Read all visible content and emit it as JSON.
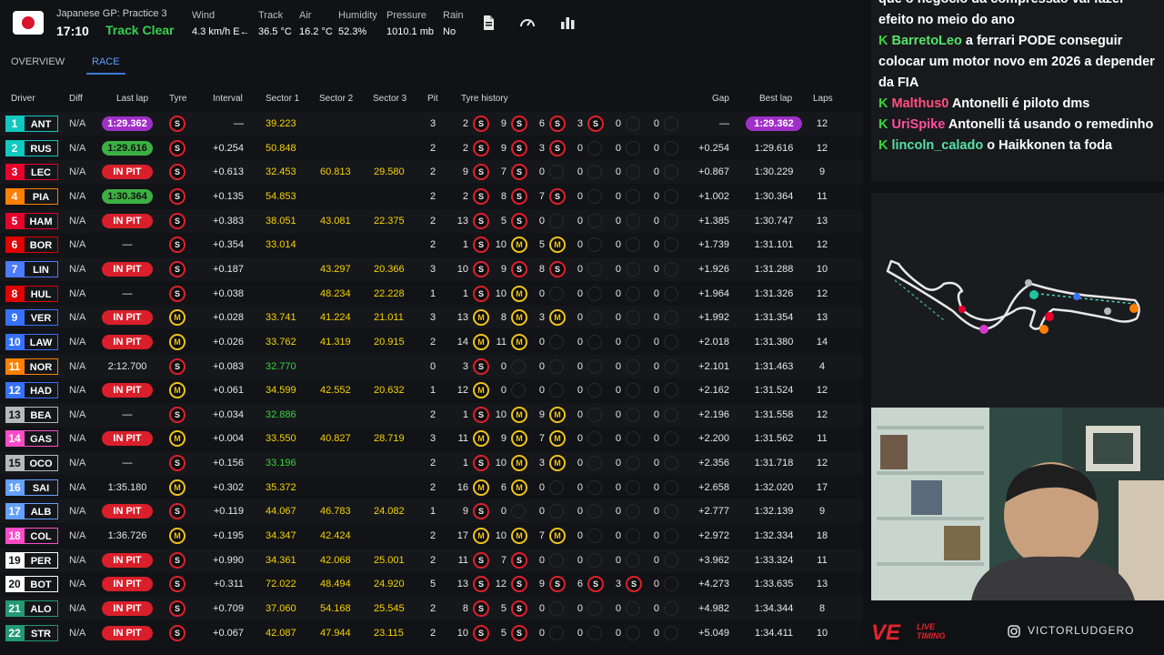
{
  "header": {
    "session": "Japanese GP: Practice 3",
    "clock": "17:10",
    "track_status": "Track Clear",
    "weather": [
      {
        "label": "Wind",
        "value": "4.3 km/h E←"
      },
      {
        "label": "Track",
        "value": "36.5 °C"
      },
      {
        "label": "Air",
        "value": "16.2 °C"
      },
      {
        "label": "Humidity",
        "value": "52.3%"
      },
      {
        "label": "Pressure",
        "value": "1010.1 mb"
      },
      {
        "label": "Rain",
        "value": "No"
      }
    ]
  },
  "tabs": [
    "OVERVIEW",
    "RACE"
  ],
  "columns": [
    "Driver",
    "Diff",
    "Last lap",
    "Tyre",
    "Interval",
    "Sector 1",
    "Sector 2",
    "Sector 3",
    "Pit",
    "Tyre history",
    "Gap",
    "Best lap",
    "Laps"
  ],
  "drivers": [
    {
      "pos": "1",
      "code": "ANT",
      "color": "#11c9c0",
      "diff": "N/A",
      "last": "1:29.362",
      "last_style": "purple",
      "tyre": "S",
      "interval": "—",
      "s1": "39.223",
      "s1c": "yellow",
      "s2": "",
      "s2c": "white",
      "s3": "",
      "s3c": "white",
      "pit": "3",
      "hist": [
        [
          "2",
          "S"
        ],
        [
          "9",
          "S"
        ],
        [
          "6",
          "S"
        ],
        [
          "3",
          "S"
        ],
        [
          "0",
          ""
        ],
        [
          "0",
          ""
        ]
      ],
      "gap": "—",
      "best": "1:29.362",
      "best_purple": true,
      "laps": "12"
    },
    {
      "pos": "2",
      "code": "RUS",
      "color": "#11c9c0",
      "diff": "N/A",
      "last": "1:29.616",
      "last_style": "green",
      "tyre": "S",
      "interval": "+0.254",
      "s1": "50.848",
      "s1c": "yellow",
      "s2": "",
      "s2c": "white",
      "s3": "",
      "s3c": "white",
      "pit": "2",
      "hist": [
        [
          "2",
          "S"
        ],
        [
          "9",
          "S"
        ],
        [
          "3",
          "S"
        ],
        [
          "0",
          ""
        ],
        [
          "0",
          ""
        ],
        [
          "0",
          ""
        ]
      ],
      "gap": "+0.254",
      "best": "1:29.616",
      "best_purple": false,
      "laps": "12"
    },
    {
      "pos": "3",
      "code": "LEC",
      "color": "#e8002d",
      "diff": "N/A",
      "last": "IN PIT",
      "last_style": "pit",
      "tyre": "S",
      "interval": "+0.613",
      "s1": "32.453",
      "s1c": "yellow",
      "s2": "60.813",
      "s2c": "yellow",
      "s3": "29.580",
      "s3c": "yellow",
      "pit": "2",
      "hist": [
        [
          "9",
          "S"
        ],
        [
          "7",
          "S"
        ],
        [
          "0",
          ""
        ],
        [
          "0",
          ""
        ],
        [
          "0",
          ""
        ],
        [
          "0",
          ""
        ]
      ],
      "gap": "+0.867",
      "best": "1:30.229",
      "best_purple": false,
      "laps": "9"
    },
    {
      "pos": "4",
      "code": "PIA",
      "color": "#ff8000",
      "diff": "N/A",
      "last": "1:30.364",
      "last_style": "green",
      "tyre": "S",
      "interval": "+0.135",
      "s1": "54.853",
      "s1c": "yellow",
      "s2": "",
      "s2c": "white",
      "s3": "",
      "s3c": "white",
      "pit": "2",
      "hist": [
        [
          "2",
          "S"
        ],
        [
          "8",
          "S"
        ],
        [
          "7",
          "S"
        ],
        [
          "0",
          ""
        ],
        [
          "0",
          ""
        ],
        [
          "0",
          ""
        ]
      ],
      "gap": "+1.002",
      "best": "1:30.364",
      "best_purple": false,
      "laps": "11"
    },
    {
      "pos": "5",
      "code": "HAM",
      "color": "#e8002d",
      "diff": "N/A",
      "last": "IN PIT",
      "last_style": "pit",
      "tyre": "S",
      "interval": "+0.383",
      "s1": "38.051",
      "s1c": "yellow",
      "s2": "43.081",
      "s2c": "yellow",
      "s3": "22.375",
      "s3c": "yellow",
      "pit": "2",
      "hist": [
        [
          "13",
          "S"
        ],
        [
          "5",
          "S"
        ],
        [
          "0",
          ""
        ],
        [
          "0",
          ""
        ],
        [
          "0",
          ""
        ],
        [
          "0",
          ""
        ]
      ],
      "gap": "+1.385",
      "best": "1:30.747",
      "best_purple": false,
      "laps": "13"
    },
    {
      "pos": "6",
      "code": "BOR",
      "color": "#e00000",
      "diff": "N/A",
      "last": "—",
      "last_style": "plain",
      "tyre": "S",
      "interval": "+0.354",
      "s1": "33.014",
      "s1c": "yellow",
      "s2": "",
      "s2c": "white",
      "s3": "",
      "s3c": "white",
      "pit": "2",
      "hist": [
        [
          "1",
          "S"
        ],
        [
          "10",
          "M"
        ],
        [
          "5",
          "M"
        ],
        [
          "0",
          ""
        ],
        [
          "0",
          ""
        ],
        [
          "0",
          ""
        ]
      ],
      "gap": "+1.739",
      "best": "1:31.101",
      "best_purple": false,
      "laps": "12"
    },
    {
      "pos": "7",
      "code": "LIN",
      "color": "#4b7bff",
      "diff": "N/A",
      "last": "IN PIT",
      "last_style": "pit",
      "tyre": "S",
      "interval": "+0.187",
      "s1": "",
      "s1c": "white",
      "s2": "43.297",
      "s2c": "yellow",
      "s3": "20.366",
      "s3c": "yellow",
      "pit": "3",
      "hist": [
        [
          "10",
          "S"
        ],
        [
          "9",
          "S"
        ],
        [
          "8",
          "S"
        ],
        [
          "0",
          ""
        ],
        [
          "0",
          ""
        ],
        [
          "0",
          ""
        ]
      ],
      "gap": "+1.926",
      "best": "1:31.288",
      "best_purple": false,
      "laps": "10"
    },
    {
      "pos": "8",
      "code": "HUL",
      "color": "#e00000",
      "diff": "N/A",
      "last": "—",
      "last_style": "plain",
      "tyre": "S",
      "interval": "+0.038",
      "s1": "",
      "s1c": "white",
      "s2": "48.234",
      "s2c": "yellow",
      "s3": "22.228",
      "s3c": "yellow",
      "pit": "1",
      "hist": [
        [
          "1",
          "S"
        ],
        [
          "10",
          "M"
        ],
        [
          "0",
          ""
        ],
        [
          "0",
          ""
        ],
        [
          "0",
          ""
        ],
        [
          "0",
          ""
        ]
      ],
      "gap": "+1.964",
      "best": "1:31.326",
      "best_purple": false,
      "laps": "12"
    },
    {
      "pos": "9",
      "code": "VER",
      "color": "#3671ff",
      "diff": "N/A",
      "last": "IN PIT",
      "last_style": "pit",
      "tyre": "M",
      "interval": "+0.028",
      "s1": "33.741",
      "s1c": "yellow",
      "s2": "41.224",
      "s2c": "yellow",
      "s3": "21.011",
      "s3c": "yellow",
      "pit": "3",
      "hist": [
        [
          "13",
          "M"
        ],
        [
          "8",
          "M"
        ],
        [
          "3",
          "M"
        ],
        [
          "0",
          ""
        ],
        [
          "0",
          ""
        ],
        [
          "0",
          ""
        ]
      ],
      "gap": "+1.992",
      "best": "1:31.354",
      "best_purple": false,
      "laps": "13"
    },
    {
      "pos": "10",
      "code": "LAW",
      "color": "#3671ff",
      "diff": "N/A",
      "last": "IN PIT",
      "last_style": "pit",
      "tyre": "M",
      "interval": "+0.026",
      "s1": "33.762",
      "s1c": "yellow",
      "s2": "41.319",
      "s2c": "yellow",
      "s3": "20.915",
      "s3c": "yellow",
      "pit": "2",
      "hist": [
        [
          "14",
          "M"
        ],
        [
          "11",
          "M"
        ],
        [
          "0",
          ""
        ],
        [
          "0",
          ""
        ],
        [
          "0",
          ""
        ],
        [
          "0",
          ""
        ]
      ],
      "gap": "+2.018",
      "best": "1:31.380",
      "best_purple": false,
      "laps": "14"
    },
    {
      "pos": "11",
      "code": "NOR",
      "color": "#ff8000",
      "diff": "N/A",
      "last": "2:12.700",
      "last_style": "plain",
      "tyre": "S",
      "interval": "+0.083",
      "s1": "32.770",
      "s1c": "green",
      "s2": "",
      "s2c": "white",
      "s3": "",
      "s3c": "white",
      "pit": "0",
      "hist": [
        [
          "3",
          "S"
        ],
        [
          "0",
          ""
        ],
        [
          "0",
          ""
        ],
        [
          "0",
          ""
        ],
        [
          "0",
          ""
        ],
        [
          "0",
          ""
        ]
      ],
      "gap": "+2.101",
      "best": "1:31.463",
      "best_purple": false,
      "laps": "4"
    },
    {
      "pos": "12",
      "code": "HAD",
      "color": "#3671ff",
      "diff": "N/A",
      "last": "IN PIT",
      "last_style": "pit",
      "tyre": "M",
      "interval": "+0.061",
      "s1": "34.599",
      "s1c": "yellow",
      "s2": "42.552",
      "s2c": "yellow",
      "s3": "20.632",
      "s3c": "yellow",
      "pit": "1",
      "hist": [
        [
          "12",
          "M"
        ],
        [
          "0",
          ""
        ],
        [
          "0",
          ""
        ],
        [
          "0",
          ""
        ],
        [
          "0",
          ""
        ],
        [
          "0",
          ""
        ]
      ],
      "gap": "+2.162",
      "best": "1:31.524",
      "best_purple": false,
      "laps": "12"
    },
    {
      "pos": "13",
      "code": "BEA",
      "color": "#b6babd",
      "diff": "N/A",
      "last": "—",
      "last_style": "plain",
      "tyre": "S",
      "interval": "+0.034",
      "s1": "32.886",
      "s1c": "green",
      "s2": "",
      "s2c": "white",
      "s3": "",
      "s3c": "white",
      "pit": "2",
      "hist": [
        [
          "1",
          "S"
        ],
        [
          "10",
          "M"
        ],
        [
          "9",
          "M"
        ],
        [
          "0",
          ""
        ],
        [
          "0",
          ""
        ],
        [
          "0",
          ""
        ]
      ],
      "gap": "+2.196",
      "best": "1:31.558",
      "best_purple": false,
      "laps": "12"
    },
    {
      "pos": "14",
      "code": "GAS",
      "color": "#ff4bc8",
      "diff": "N/A",
      "last": "IN PIT",
      "last_style": "pit",
      "tyre": "M",
      "interval": "+0.004",
      "s1": "33.550",
      "s1c": "yellow",
      "s2": "40.827",
      "s2c": "yellow",
      "s3": "28.719",
      "s3c": "yellow",
      "pit": "3",
      "hist": [
        [
          "11",
          "M"
        ],
        [
          "9",
          "M"
        ],
        [
          "7",
          "M"
        ],
        [
          "0",
          ""
        ],
        [
          "0",
          ""
        ],
        [
          "0",
          ""
        ]
      ],
      "gap": "+2.200",
      "best": "1:31.562",
      "best_purple": false,
      "laps": "11"
    },
    {
      "pos": "15",
      "code": "OCO",
      "color": "#b6babd",
      "diff": "N/A",
      "last": "—",
      "last_style": "plain",
      "tyre": "S",
      "interval": "+0.156",
      "s1": "33.196",
      "s1c": "green",
      "s2": "",
      "s2c": "white",
      "s3": "",
      "s3c": "white",
      "pit": "2",
      "hist": [
        [
          "1",
          "S"
        ],
        [
          "10",
          "M"
        ],
        [
          "3",
          "M"
        ],
        [
          "0",
          ""
        ],
        [
          "0",
          ""
        ],
        [
          "0",
          ""
        ]
      ],
      "gap": "+2.356",
      "best": "1:31.718",
      "best_purple": false,
      "laps": "12"
    },
    {
      "pos": "16",
      "code": "SAI",
      "color": "#64a0ff",
      "diff": "N/A",
      "last": "1:35.180",
      "last_style": "plain",
      "tyre": "M",
      "interval": "+0.302",
      "s1": "35.372",
      "s1c": "yellow",
      "s2": "",
      "s2c": "white",
      "s3": "",
      "s3c": "white",
      "pit": "2",
      "hist": [
        [
          "16",
          "M"
        ],
        [
          "6",
          "M"
        ],
        [
          "0",
          ""
        ],
        [
          "0",
          ""
        ],
        [
          "0",
          ""
        ],
        [
          "0",
          ""
        ]
      ],
      "gap": "+2.658",
      "best": "1:32.020",
      "best_purple": false,
      "laps": "17"
    },
    {
      "pos": "17",
      "code": "ALB",
      "color": "#64a0ff",
      "diff": "N/A",
      "last": "IN PIT",
      "last_style": "pit",
      "tyre": "S",
      "interval": "+0.119",
      "s1": "44.067",
      "s1c": "yellow",
      "s2": "46.783",
      "s2c": "yellow",
      "s3": "24.082",
      "s3c": "yellow",
      "pit": "1",
      "hist": [
        [
          "9",
          "S"
        ],
        [
          "0",
          ""
        ],
        [
          "0",
          ""
        ],
        [
          "0",
          ""
        ],
        [
          "0",
          ""
        ],
        [
          "0",
          ""
        ]
      ],
      "gap": "+2.777",
      "best": "1:32.139",
      "best_purple": false,
      "laps": "9"
    },
    {
      "pos": "18",
      "code": "COL",
      "color": "#ff4bc8",
      "diff": "N/A",
      "last": "1:36.726",
      "last_style": "plain",
      "tyre": "M",
      "interval": "+0.195",
      "s1": "34.347",
      "s1c": "yellow",
      "s2": "42.424",
      "s2c": "yellow",
      "s3": "",
      "s3c": "white",
      "pit": "2",
      "hist": [
        [
          "17",
          "M"
        ],
        [
          "10",
          "M"
        ],
        [
          "7",
          "M"
        ],
        [
          "0",
          ""
        ],
        [
          "0",
          ""
        ],
        [
          "0",
          ""
        ]
      ],
      "gap": "+2.972",
      "best": "1:32.334",
      "best_purple": false,
      "laps": "18"
    },
    {
      "pos": "19",
      "code": "PER",
      "color": "#ffffff",
      "diff": "N/A",
      "last": "IN PIT",
      "last_style": "pit",
      "tyre": "S",
      "interval": "+0.990",
      "s1": "34.361",
      "s1c": "yellow",
      "s2": "42.068",
      "s2c": "yellow",
      "s3": "25.001",
      "s3c": "yellow",
      "pit": "2",
      "hist": [
        [
          "11",
          "S"
        ],
        [
          "7",
          "S"
        ],
        [
          "0",
          ""
        ],
        [
          "0",
          ""
        ],
        [
          "0",
          ""
        ],
        [
          "0",
          ""
        ]
      ],
      "gap": "+3.962",
      "best": "1:33.324",
      "best_purple": false,
      "laps": "11"
    },
    {
      "pos": "20",
      "code": "BOT",
      "color": "#ffffff",
      "diff": "N/A",
      "last": "IN PIT",
      "last_style": "pit",
      "tyre": "S",
      "interval": "+0.311",
      "s1": "72.022",
      "s1c": "yellow",
      "s2": "48.494",
      "s2c": "yellow",
      "s3": "24.920",
      "s3c": "yellow",
      "pit": "5",
      "hist": [
        [
          "13",
          "S"
        ],
        [
          "12",
          "S"
        ],
        [
          "9",
          "S"
        ],
        [
          "6",
          "S"
        ],
        [
          "3",
          "S"
        ],
        [
          "0",
          ""
        ]
      ],
      "gap": "+4.273",
      "best": "1:33.635",
      "best_purple": false,
      "laps": "13"
    },
    {
      "pos": "21",
      "code": "ALO",
      "color": "#229971",
      "diff": "N/A",
      "last": "IN PIT",
      "last_style": "pit",
      "tyre": "S",
      "interval": "+0.709",
      "s1": "37.060",
      "s1c": "yellow",
      "s2": "54.168",
      "s2c": "yellow",
      "s3": "25.545",
      "s3c": "yellow",
      "pit": "2",
      "hist": [
        [
          "8",
          "S"
        ],
        [
          "5",
          "S"
        ],
        [
          "0",
          ""
        ],
        [
          "0",
          ""
        ],
        [
          "0",
          ""
        ],
        [
          "0",
          ""
        ]
      ],
      "gap": "+4.982",
      "best": "1:34.344",
      "best_purple": false,
      "laps": "8"
    },
    {
      "pos": "22",
      "code": "STR",
      "color": "#229971",
      "diff": "N/A",
      "last": "IN PIT",
      "last_style": "pit",
      "tyre": "S",
      "interval": "+0.067",
      "s1": "42.087",
      "s1c": "yellow",
      "s2": "47.944",
      "s2c": "yellow",
      "s3": "23.115",
      "s3c": "yellow",
      "pit": "2",
      "hist": [
        [
          "10",
          "S"
        ],
        [
          "5",
          "S"
        ],
        [
          "0",
          ""
        ],
        [
          "0",
          ""
        ],
        [
          "0",
          ""
        ],
        [
          "0",
          ""
        ]
      ],
      "gap": "+5.049",
      "best": "1:34.411",
      "best_purple": false,
      "laps": "10"
    }
  ],
  "chat": [
    {
      "user": "",
      "user_color": "#ffffff",
      "text": "que o negocio da compressao vai fazer efeito no meio do ano"
    },
    {
      "user": "BarretoLeo",
      "user_color": "#55e36a",
      "text": "a ferrari PODE conseguir colocar um motor novo em 2026 a depender da FIA"
    },
    {
      "user": "Malthus0",
      "user_color": "#ff4f7f",
      "text": "Antonelli é piloto dms"
    },
    {
      "user": "UriSpike",
      "user_color": "#ff4f9f",
      "text": "Antonelli tá usando o remedinho"
    },
    {
      "user": "lincoln_calado",
      "user_color": "#55e3a6",
      "text": "o Haikkonen ta foda"
    }
  ],
  "footer": {
    "logo": "VE",
    "logo_sub1": "LIVE",
    "logo_sub2": "TIMING",
    "handle": "VICTORLUDGERO"
  },
  "colors": {
    "pit": "#d91f2a",
    "purple": "#a02fc8",
    "green": "#3cb043",
    "soft": "#e0202c",
    "medium": "#f0c419"
  }
}
